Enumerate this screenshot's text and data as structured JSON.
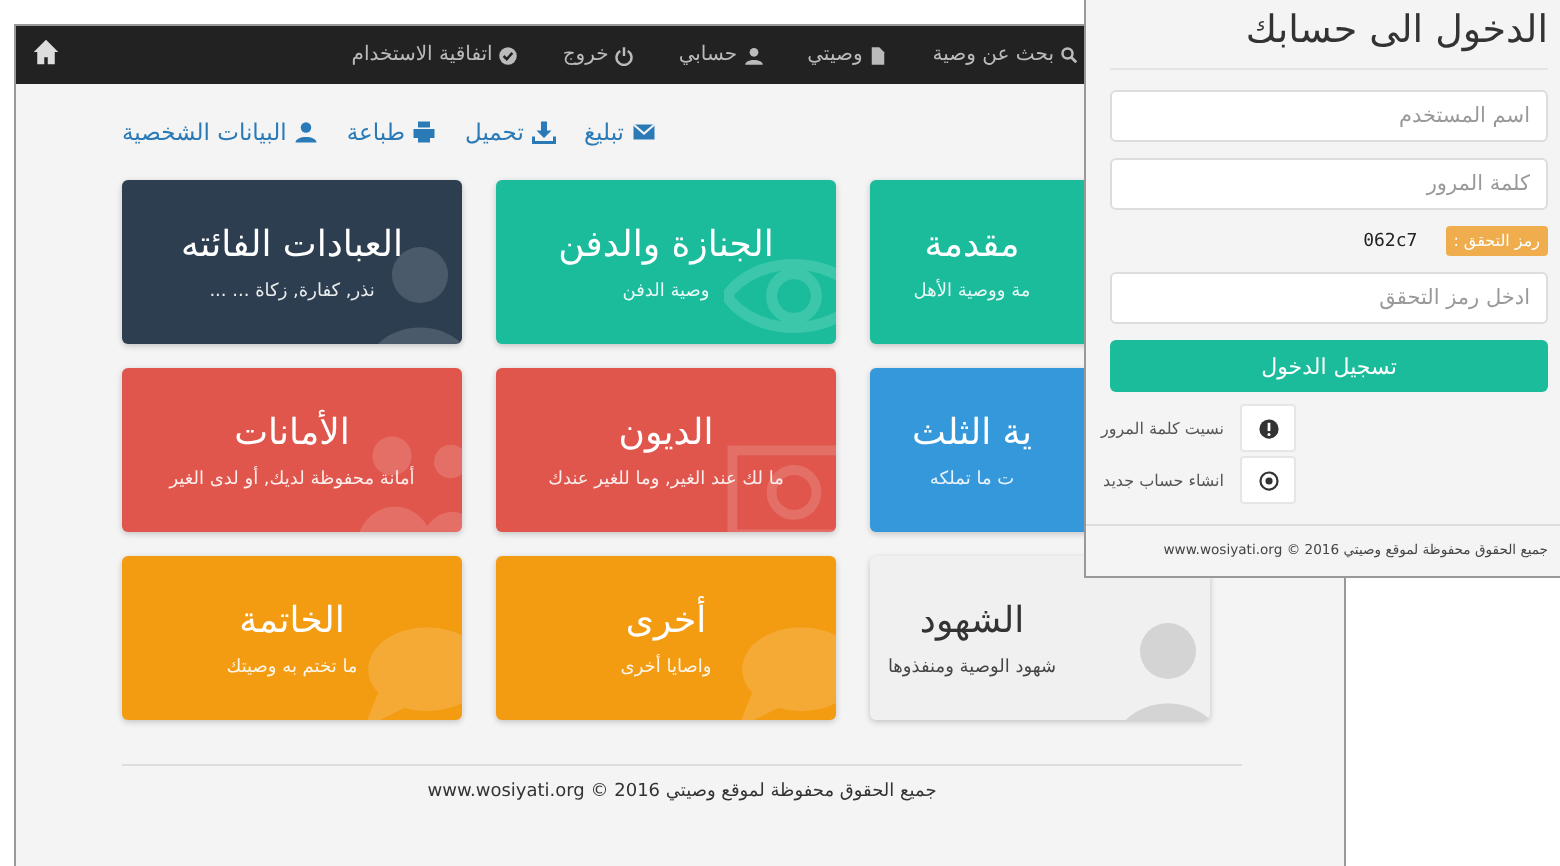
{
  "navbar": {
    "items": [
      {
        "label": "بحث عن وصية"
      },
      {
        "label": "وصيتي"
      },
      {
        "label": "حسابي"
      },
      {
        "label": "خروج"
      },
      {
        "label": "اتفاقية الاستخدام"
      }
    ]
  },
  "actions": [
    {
      "label": "تبليغ"
    },
    {
      "label": "تحميل"
    },
    {
      "label": "طباعة"
    },
    {
      "label": "البيانات الشخصية"
    }
  ],
  "tiles": [
    {
      "title": "مقدمة",
      "subtitle": "مة ووصية الأهل",
      "color": "#1abc9c"
    },
    {
      "title": "الجنازة والدفن",
      "subtitle": "وصية الدفن",
      "color": "#1abc9c"
    },
    {
      "title": "العبادات الفائته",
      "subtitle": "نذر, كفارة, زكاة ... ...",
      "color": "#2c3e50"
    },
    {
      "title": "ية الثلث",
      "subtitle": "ت ما تملكه",
      "color": "#3498db"
    },
    {
      "title": "الديون",
      "subtitle": "ما لك عند الغير, وما للغير عندك",
      "color": "#e0564c"
    },
    {
      "title": "الأمانات",
      "subtitle": "أمانة محفوظة لديك, أو لدى الغير",
      "color": "#e0564c"
    },
    {
      "title": "الشهود",
      "subtitle": "شهود الوصية ومنفذوها",
      "color": "#f0f0f0"
    },
    {
      "title": "أخرى",
      "subtitle": "واصايا أخرى",
      "color": "#f39c12"
    },
    {
      "title": "الخاتمة",
      "subtitle": "ما تختم به وصيتك",
      "color": "#f39c12"
    }
  ],
  "footer": "جميع الحقوق محفوظة لموقع وصيتي 2016 © www.wosiyati.org",
  "login": {
    "title": "الدخول الى حسابك",
    "username": {
      "placeholder": "اسم المستخدم"
    },
    "password": {
      "placeholder": "كلمة المرور"
    },
    "captcha_label": "رمز التحقق :",
    "captcha_code": "062c7",
    "captcha": {
      "placeholder": "ادخل رمز التحقق"
    },
    "submit": "تسجيل الدخول",
    "links": [
      {
        "label": "نسيت كلمة المرور"
      },
      {
        "label": "انشاء حساب جديد"
      }
    ],
    "footer": "جميع الحقوق محفوظة لموقع وصيتي 2016 © www.wosiyati.org"
  }
}
